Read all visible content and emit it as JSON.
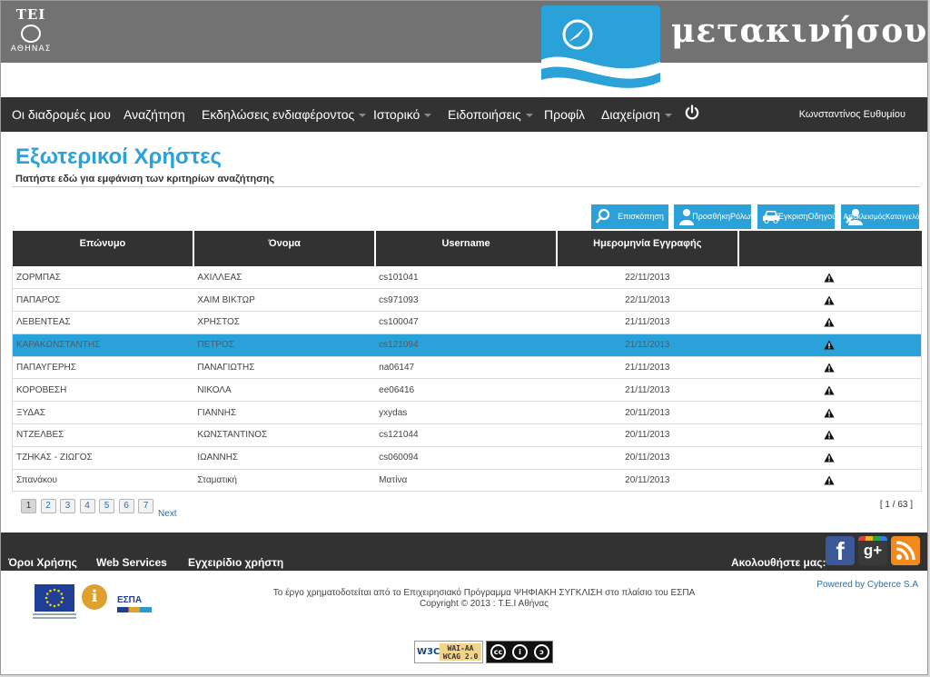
{
  "header": {
    "tei_logo_top": "ΤΕΙ",
    "tei_logo_bottom": "ΑΘΗΝΑΣ",
    "brand_text": "μετακινήσου..."
  },
  "nav": {
    "items": [
      {
        "label": "Οι διαδρομές μου",
        "dropdown": false
      },
      {
        "label": "Αναζήτηση",
        "dropdown": false
      },
      {
        "label": "Εκδηλώσεις ενδιαφέροντος",
        "dropdown": true
      },
      {
        "label": "Ιστορικό",
        "dropdown": true
      },
      {
        "label": "Ειδοποιήσεις",
        "dropdown": true
      },
      {
        "label": "Προφίλ",
        "dropdown": false
      },
      {
        "label": "Διαχείριση",
        "dropdown": true
      }
    ],
    "power_icon": "power-icon",
    "user_name": "Κωνσταντίνος Ευθυμίου"
  },
  "page": {
    "title": "Εξωτερικοί Χρήστες",
    "search_toggle": "Πατήστε εδώ για εμφάνιση των κριτηρίων αναζήτησης"
  },
  "actions": {
    "preview": "Επισκόπηση",
    "add_roles_1": "Προσθήκη",
    "add_roles_2": "Ρόλων",
    "approve_driver_1": "Έγκριση",
    "approve_driver_2": "Οδηγού",
    "exclude_1": "Αποκλεισμός",
    "exclude_2": "Καταγγελόμενου"
  },
  "table": {
    "headers": [
      "Επώνυμο",
      "Όνομα",
      "Username",
      "Ημερομηνία Εγγραφής",
      ""
    ],
    "selected_index": 3,
    "rows": [
      {
        "surname": "ΖΟΡΜΠΑΣ",
        "name": "ΑΧΙΛΛΕΑΣ",
        "username": "cs101041",
        "date": "22/11/2013"
      },
      {
        "surname": "ΠΑΠΑΡΟΣ",
        "name": "ΧΑΙΜ ΒΙΚΤΩΡ",
        "username": "cs971093",
        "date": "22/11/2013"
      },
      {
        "surname": "ΛΕΒΕΝΤΕΑΣ",
        "name": "ΧΡΗΣΤΟΣ",
        "username": "cs100047",
        "date": "21/11/2013"
      },
      {
        "surname": "ΚΑΡΑΚΩΝΣΤΑΝΤΗΣ",
        "name": "ΠΕΤΡΟΣ",
        "username": "cs121094",
        "date": "21/11/2013"
      },
      {
        "surname": "ΠΑΠΑΥΓΕΡΗΣ",
        "name": "ΠΑΝΑΓΙΩΤΗΣ",
        "username": "na06147",
        "date": "21/11/2013"
      },
      {
        "surname": "ΚΟΡΟΒΕΣΗ",
        "name": "ΝΙΚΟΛΑ",
        "username": "ee06416",
        "date": "21/11/2013"
      },
      {
        "surname": "ΞΥΔΑΣ",
        "name": "ΓΙΑΝΝΗΣ",
        "username": "yxydas",
        "date": "20/11/2013"
      },
      {
        "surname": "ΝΤΖΕΛΒΕΣ",
        "name": "ΚΩΝΣΤΑΝΤΙΝΟΣ",
        "username": "cs121044",
        "date": "20/11/2013"
      },
      {
        "surname": "ΤΖΗΚΑΣ - ΖΙΩΓΟΣ",
        "name": "ΙΩΑΝΝΗΣ",
        "username": "cs060094",
        "date": "20/11/2013"
      },
      {
        "surname": "Σπανάκου",
        "name": "Σταματική",
        "username": "Ματίνα",
        "date": "20/11/2013"
      }
    ],
    "row_icon": "warning-icon"
  },
  "pager": {
    "pages": [
      "1",
      "2",
      "3",
      "4",
      "5",
      "6",
      "7"
    ],
    "current": "1",
    "next": "Next",
    "count": "[ 1 / 63 ]"
  },
  "footer": {
    "links": [
      "Όροι Χρήσης",
      "Web Services",
      "Εγχειρίδιο χρήστη"
    ],
    "follow": "Ακολουθήστε μας:",
    "fb": "f",
    "gplus": "g+",
    "note_line1": "Το έργο χρηματοδοτείται από το Επιχειρησιακό Πρόγραμμα ΨΗΦΙΑΚΗ ΣΥΓΚΛΙΣΗ στο πλαίσιο του ΕΣΠΑ",
    "note_line2": "Copyright © 2013 : Τ.Ε.Ι Αθήνας",
    "powered": "Powered by Cyberce S.A",
    "espa": "ΕΣΠΑ",
    "w3c": "W3C",
    "wai_1": "WAI-AA",
    "wai_2": "WCAG 2.0",
    "cc_1": "cc",
    "cc_2": "i",
    "cc_3": "ↄ"
  },
  "colors": {
    "accent": "#2aa1d8",
    "nav_bg": "#323232",
    "header_bg": "#727272"
  }
}
